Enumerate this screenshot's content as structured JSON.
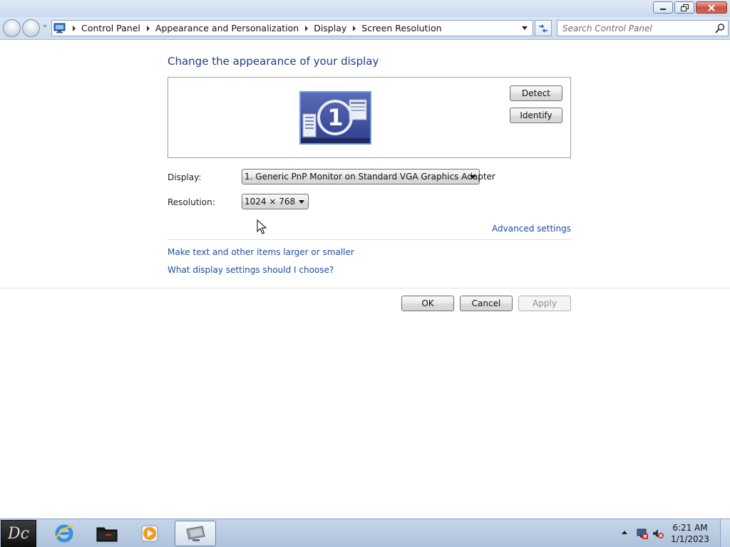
{
  "window": {
    "caption_buttons": [
      "minimize-icon",
      "restore-icon",
      "close-icon"
    ]
  },
  "address_bar": {
    "breadcrumbs": [
      "Control Panel",
      "Appearance and Personalization",
      "Display",
      "Screen Resolution"
    ],
    "search_placeholder": "Search Control Panel"
  },
  "main": {
    "heading": "Change the appearance of your display",
    "monitor_number": "1",
    "detect_label": "Detect",
    "identify_label": "Identify",
    "display_label": "Display:",
    "display_value": "1. Generic PnP Monitor on Standard VGA Graphics Adapter",
    "resolution_label": "Resolution:",
    "resolution_value": "1024 × 768",
    "advanced_link": "Advanced settings",
    "text_size_link": "Make text and other items larger or smaller",
    "help_link": "What display settings should I choose?"
  },
  "footer": {
    "ok_label": "OK",
    "cancel_label": "Cancel",
    "apply_label": "Apply"
  },
  "taskbar": {
    "time": "6:21 AM",
    "date": "1/1/2023",
    "start_text": "Dc"
  },
  "colors": {
    "heading": "#1e3c8e",
    "link": "#1e4ca0"
  }
}
